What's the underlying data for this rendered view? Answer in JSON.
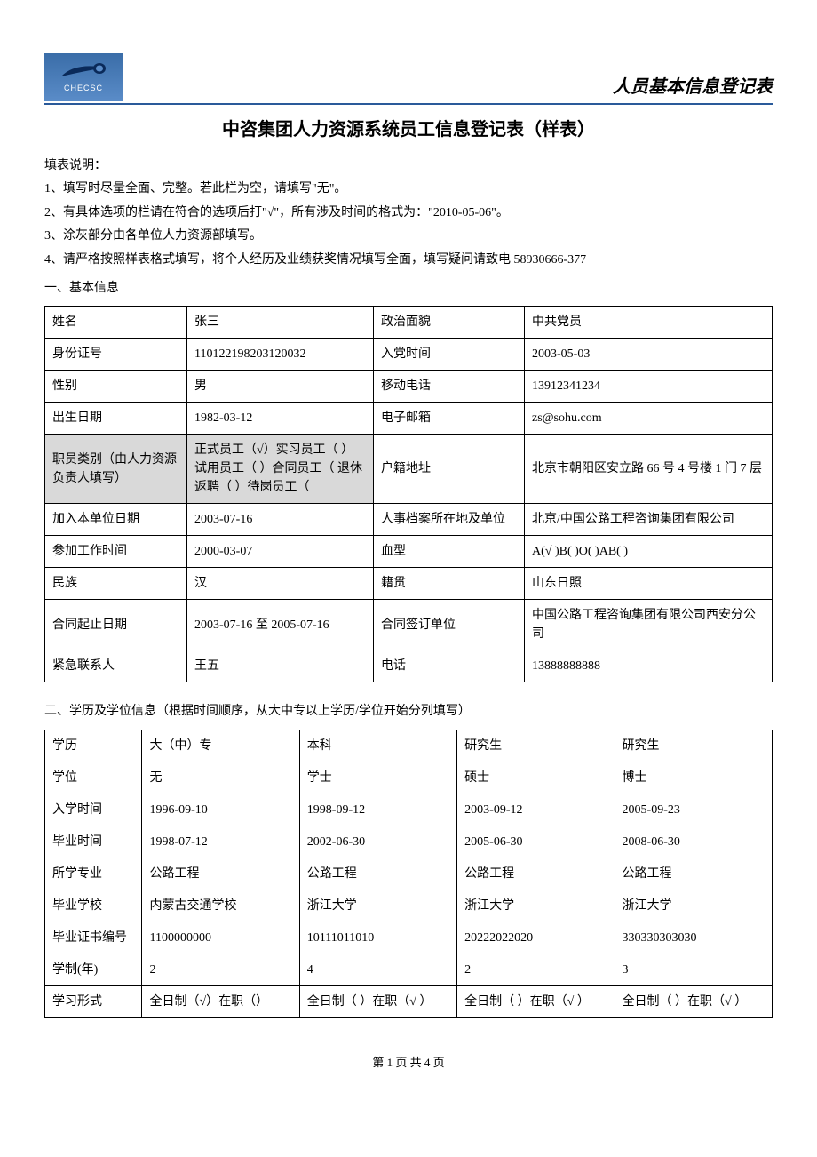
{
  "header": {
    "logo_text": "CHECSC",
    "doc_type": "人员基本信息登记表"
  },
  "main_title": "中咨集团人力资源系统员工信息登记表（样表）",
  "instructions": {
    "header": "填表说明：",
    "item1": "1、填写时尽量全面、完整。若此栏为空，请填写\"无\"。",
    "item2": "2、有具体选项的栏请在符合的选项后打\"√\"，所有涉及时间的格式为：\"2010-05-06\"。",
    "item3": "3、涂灰部分由各单位人力资源部填写。",
    "item4": "4、请严格按照样表格式填写，将个人经历及业绩获奖情况填写全面，填写疑问请致电 58930666-377"
  },
  "section1": {
    "title": "一、基本信息",
    "rows": {
      "name_l": "姓名",
      "name_v": "张三",
      "political_l": "政治面貌",
      "political_v": "中共党员",
      "id_l": "身份证号",
      "id_v": "110122198203120032",
      "party_date_l": "入党时间",
      "party_date_v": "2003-05-03",
      "gender_l": "性别",
      "gender_v": "男",
      "mobile_l": "移动电话",
      "mobile_v": "13912341234",
      "dob_l": "出生日期",
      "dob_v": "1982-03-12",
      "email_l": "电子邮箱",
      "email_v": "zs@sohu.com",
      "category_l": "职员类别（由人力资源负责人填写）",
      "category_v": "正式员工（√）实习员工（ ）试用员工（  ）合同员工（  退休返聘（  ）待岗员工（",
      "addr_l": "户籍地址",
      "addr_v": "北京市朝阳区安立路 66 号 4 号楼 1 门 7 层",
      "join_l": "加入本单位日期",
      "join_v": "2003-07-16",
      "archive_l": "人事档案所在地及单位",
      "archive_v": "北京/中国公路工程咨询集团有限公司",
      "work_start_l": "参加工作时间",
      "work_start_v": "2000-03-07",
      "blood_l": "血型",
      "blood_v": "A(√ )B(  )O(  )AB(  )",
      "ethnic_l": "民族",
      "ethnic_v": "汉",
      "native_l": "籍贯",
      "native_v": "山东日照",
      "contract_l": "合同起止日期",
      "contract_v": "2003-07-16 至 2005-07-16",
      "contract_unit_l": "合同签订单位",
      "contract_unit_v": "中国公路工程咨询集团有限公司西安分公司",
      "emergency_l": "紧急联系人",
      "emergency_v": "王五",
      "emergency_tel_l": "电话",
      "emergency_tel_v": "13888888888"
    }
  },
  "section2": {
    "title": "二、学历及学位信息（根据时间顺序，从大中专以上学历/学位开始分列填写）",
    "labels": {
      "edu": "学历",
      "degree": "学位",
      "enroll": "入学时间",
      "grad": "毕业时间",
      "major": "所学专业",
      "school": "毕业学校",
      "cert": "毕业证书编号",
      "years": "学制(年)",
      "mode": "学习形式"
    },
    "cols": [
      {
        "edu": "大（中）专",
        "degree": "无",
        "enroll": "1996-09-10",
        "grad": "1998-07-12",
        "major": "公路工程",
        "school": "内蒙古交通学校",
        "cert": "1100000000",
        "years": "2",
        "mode": "全日制（√）在职（）"
      },
      {
        "edu": "本科",
        "degree": "学士",
        "enroll": "1998-09-12",
        "grad": "2002-06-30",
        "major": "公路工程",
        "school": "浙江大学",
        "cert": "10111011010",
        "years": "4",
        "mode": "全日制（ ）在职（√ ）"
      },
      {
        "edu": "研究生",
        "degree": "硕士",
        "enroll": "2003-09-12",
        "grad": "2005-06-30",
        "major": "公路工程",
        "school": "浙江大学",
        "cert": "20222022020",
        "years": "2",
        "mode": "全日制（ ）在职（√ ）"
      },
      {
        "edu": "研究生",
        "degree": "博士",
        "enroll": "2005-09-23",
        "grad": "2008-06-30",
        "major": "公路工程",
        "school": "浙江大学",
        "cert": "330330303030",
        "years": "3",
        "mode": "全日制（ ）在职（√ ）"
      }
    ]
  },
  "footer": "第 1 页 共 4 页"
}
